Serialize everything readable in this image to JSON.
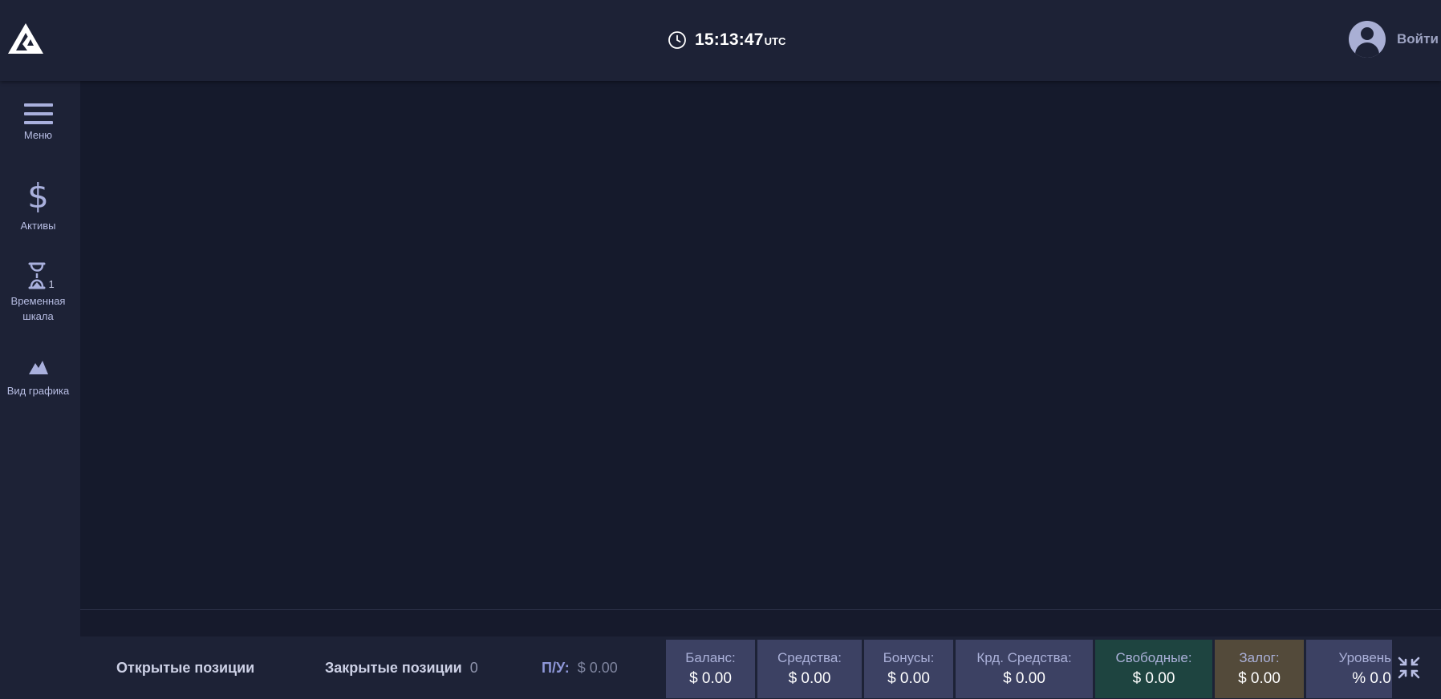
{
  "header": {
    "time": "15:13:47",
    "timezone": "UTC",
    "login_label": "Войти"
  },
  "sidebar": {
    "items": [
      {
        "label": "Меню",
        "icon": "hamburger-menu-icon"
      },
      {
        "label": "Активы",
        "icon": "dollar-icon"
      },
      {
        "label_line1": "Временная",
        "label_line2": "шкала",
        "icon": "hourglass-icon",
        "badge": "1"
      },
      {
        "label": "Вид графика",
        "icon": "mountain-chart-icon"
      }
    ]
  },
  "bottom": {
    "open_positions": "Открытые позиции",
    "closed_positions": "Закрытые позиции",
    "closed_count": "0",
    "pnl_label": "П/У:",
    "pnl_value": "$ 0.00",
    "stats": [
      {
        "label": "Баланс:",
        "value": "$ 0.00"
      },
      {
        "label": "Средства:",
        "value": "$ 0.00"
      },
      {
        "label": "Бонусы:",
        "value": "$ 0.00"
      },
      {
        "label": "Крд. Средства:",
        "value": "$ 0.00"
      },
      {
        "label": "Свободные:",
        "value": "$ 0.00"
      },
      {
        "label": "Залог:",
        "value": "$ 0.00"
      },
      {
        "label": "Уровень м",
        "value": "% 0.0"
      }
    ]
  },
  "colors": {
    "background": "#161a2c",
    "panel": "#1d2236",
    "stat_box": "#3c4163",
    "free_box": "#1e4440",
    "collateral_box": "#534a3a",
    "accent": "#a9b0dd"
  }
}
